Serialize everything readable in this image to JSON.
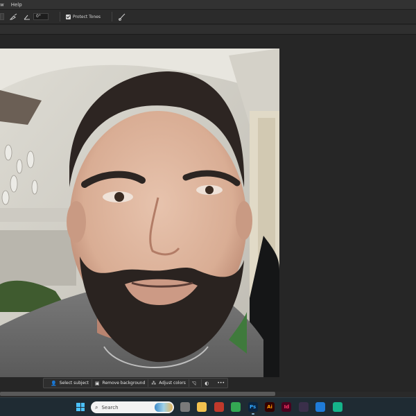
{
  "menubar": {
    "items": [
      "w",
      "Help"
    ]
  },
  "options": {
    "angle_value": "0°",
    "protect_tones_label": "Protect Tones"
  },
  "context_bar": {
    "select_subject": "Select subject",
    "remove_background": "Remove background",
    "adjust_colors": "Adjust colors",
    "more": "•••"
  },
  "taskbar": {
    "search_placeholder": "Search",
    "apps": [
      {
        "label": "",
        "color": "#7a7a7a"
      },
      {
        "label": "",
        "color": "#f2c14e"
      },
      {
        "label": "",
        "color": "#c0392b"
      },
      {
        "label": "",
        "color": "#34a853"
      },
      {
        "label": "Ps",
        "color": "#0b2440",
        "fg": "#31a8ff"
      },
      {
        "label": "Ai",
        "color": "#330000",
        "fg": "#ff9a00"
      },
      {
        "label": "Id",
        "color": "#49021f",
        "fg": "#ff3366"
      },
      {
        "label": "",
        "color": "#3a2f4a"
      },
      {
        "label": "",
        "color": "#1f7bd8"
      },
      {
        "label": "",
        "color": "#15b38a"
      }
    ]
  },
  "colors": {
    "accent": "#31a8ff",
    "taskbar_bg": "#1f2b33",
    "panel_bg": "#262626"
  }
}
